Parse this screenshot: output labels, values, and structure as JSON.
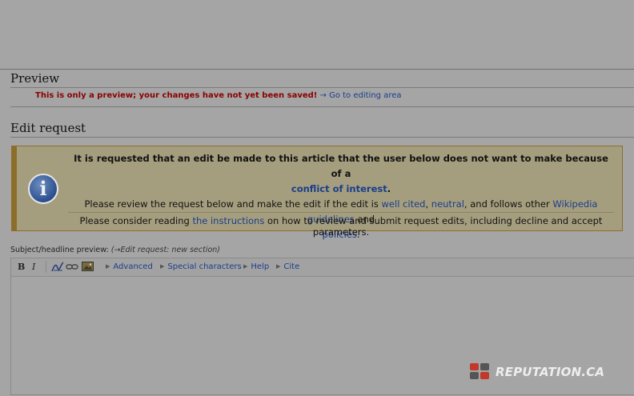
{
  "sections": {
    "preview_title": "Preview",
    "edit_request_title": "Edit request"
  },
  "preview": {
    "warning": "This is only a preview; your changes have not yet been saved!",
    "goto": "→ Go to editing area"
  },
  "notice": {
    "line1": "It is requested that an edit be made to this article that the user below does not want to make because of a",
    "coi_link": "conflict of interest",
    "line2_pre": "Please review the request below and make the edit if the edit is",
    "well_cited": "well cited",
    "neutral": "neutral",
    "line2_mid": ", and follows other",
    "guidelines": "Wikipedia guidelines",
    "and": "and",
    "policies": "policies",
    "footer_pre": "Please consider reading",
    "instructions": "the instructions",
    "footer_post": "on how to review and submit request edits, including decline and accept parameters."
  },
  "subject": {
    "label": "Subject/headline preview:",
    "arrow": "(→",
    "summary": "Edit request:",
    "new_section": "new section)"
  },
  "toolbar": {
    "bold": "B",
    "italic": "I",
    "advanced": "Advanced",
    "special_characters": "Special characters",
    "help": "Help",
    "cite": "Cite"
  },
  "watermark": "REPUTATION.CA",
  "colors": {
    "link": "#1a3e8c",
    "warning": "#8a0000",
    "notice_bg": "#a59e7e",
    "notice_border": "#8d6d2a",
    "overlay": "#a5a5a5",
    "logo_red": "#c0392b"
  }
}
